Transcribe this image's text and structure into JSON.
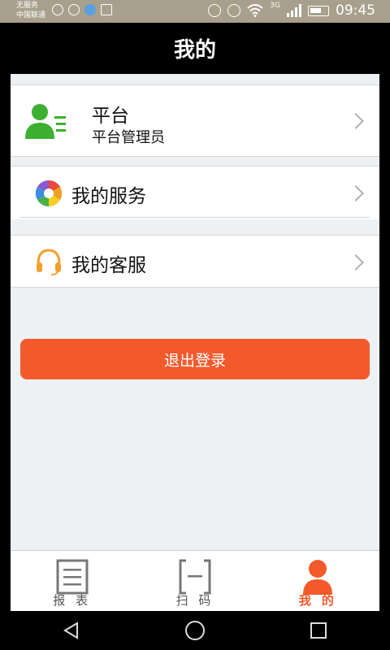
{
  "status_bar": {
    "carrier_line1": "无服务",
    "carrier_line2": "中国联通",
    "network": "3G",
    "time": "09:45"
  },
  "header": {
    "title": "我的"
  },
  "user": {
    "title": "平台",
    "subtitle": "平台管理员",
    "icon": "user-list-icon"
  },
  "menu": [
    {
      "label": "我的服务",
      "icon": "aperture-icon"
    },
    {
      "label": "我的客服",
      "icon": "headset-icon"
    }
  ],
  "logout_label": "退出登录",
  "tabs": [
    {
      "label": "报 表",
      "icon": "report-icon"
    },
    {
      "label": "扫 码",
      "icon": "scan-icon"
    },
    {
      "label": "我 的",
      "icon": "person-icon",
      "active": true
    }
  ],
  "colors": {
    "accent": "#f25a2c",
    "user_icon": "#3cb030",
    "statusbar": "#a8a08c",
    "headset": "#f0a030"
  }
}
